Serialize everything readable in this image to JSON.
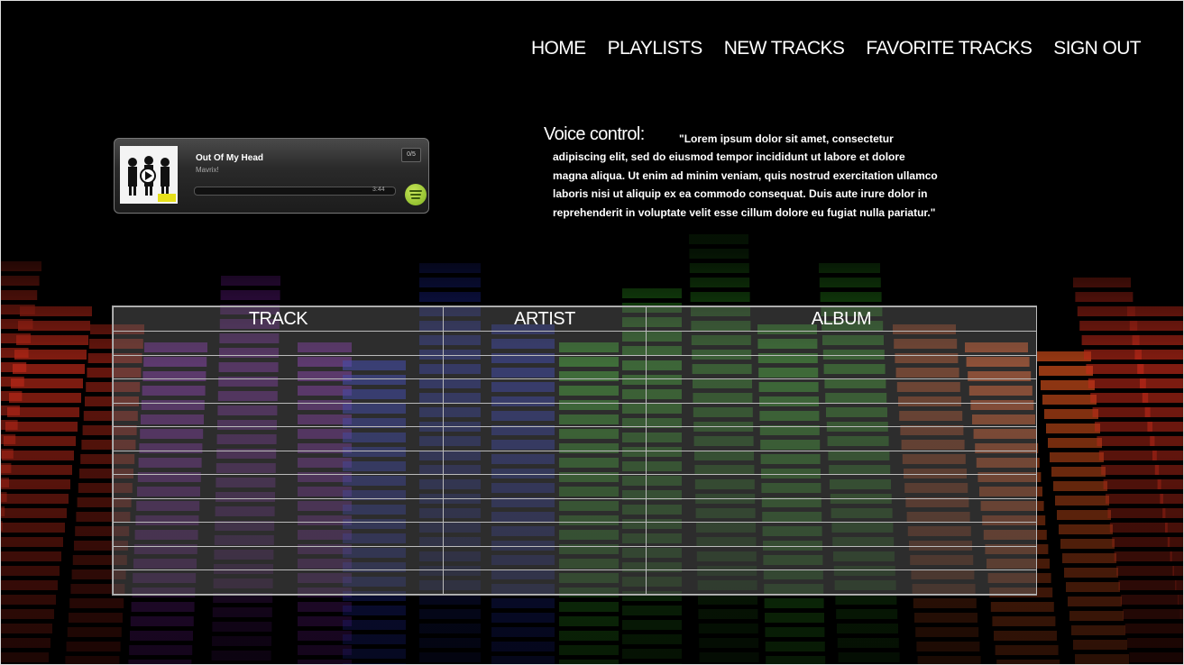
{
  "nav": {
    "home": "HOME",
    "playlists": "PLAYLISTS",
    "new_tracks": "NEW TRACKS",
    "favorite_tracks": "FAVORITE TRACKS",
    "sign_out": "SIGN OUT"
  },
  "player": {
    "track_title": "Out Of My Head",
    "artist": "Mavrix!",
    "counter": "0/5",
    "time": "3:44",
    "progress": 0.0,
    "album_art_icon": "band-photo-icon",
    "service_icon": "spotify-icon"
  },
  "voice_control": {
    "label": "Voice control:",
    "text": "\"Lorem ipsum dolor sit amet, consectetur adipiscing elit, sed do eiusmod tempor incididunt ut labore et dolore magna aliqua. Ut enim ad minim veniam, quis nostrud exercitation ullamco laboris nisi ut aliquip ex ea commodo consequat. Duis aute irure dolor in reprehenderit in voluptate velit esse cillum dolore eu fugiat nulla pariatur.\""
  },
  "table": {
    "headers": [
      "TRACK",
      "ARTIST",
      "ALBUM"
    ],
    "rows": [
      [
        "",
        "",
        ""
      ],
      [
        "",
        "",
        ""
      ],
      [
        "",
        "",
        ""
      ],
      [
        "",
        "",
        ""
      ],
      [
        "",
        "",
        ""
      ],
      [
        "",
        "",
        ""
      ],
      [
        "",
        "",
        ""
      ],
      [
        "",
        "",
        ""
      ],
      [
        "",
        "",
        ""
      ],
      [
        "",
        "",
        ""
      ],
      [
        "",
        "",
        ""
      ]
    ]
  },
  "colors": {
    "background": "#000000",
    "eq_red": "#e8321e",
    "eq_purple": "#a02ad8",
    "eq_blue": "#2a3ae8",
    "eq_green": "#3ed82a",
    "eq_orange": "#f05a1e",
    "spotify_green": "#9bd130"
  }
}
